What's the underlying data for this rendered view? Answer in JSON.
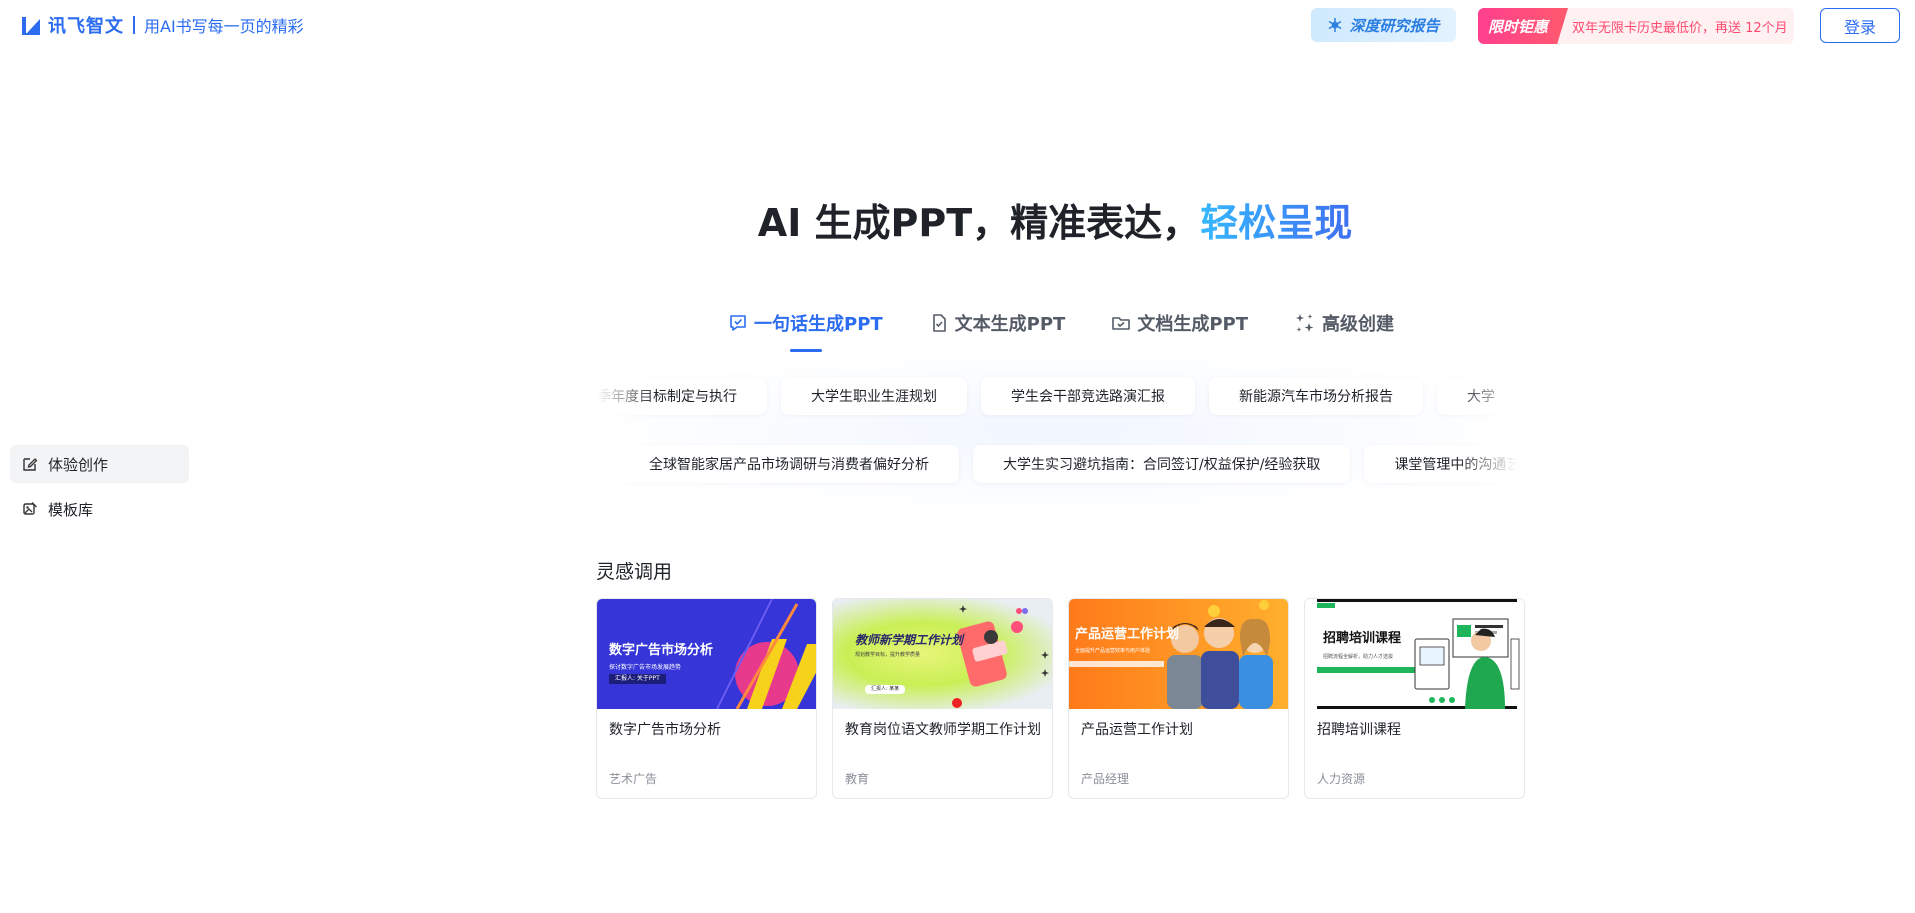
{
  "header": {
    "logo_name": "讯飞智文",
    "slogan": "用AI书写每一页的精彩",
    "deep_report": "深度研究报告",
    "promo_tag": "限时钜惠",
    "promo_text": "双年无限卡历史最低价，再送 12个月",
    "login": "登录"
  },
  "sidebar": {
    "items": [
      {
        "label": "体验创作",
        "icon": "edit-icon"
      },
      {
        "label": "模板库",
        "icon": "template-icon"
      }
    ]
  },
  "hero": {
    "title_main": "AI 生成PPT，精准表达，",
    "title_accent": "轻松呈现"
  },
  "tabs": [
    {
      "label": "一句话生成PPT",
      "icon": "chat-check-icon",
      "active": true
    },
    {
      "label": "文本生成PPT",
      "icon": "doc-check-icon",
      "active": false
    },
    {
      "label": "文档生成PPT",
      "icon": "folder-check-icon",
      "active": false
    },
    {
      "label": "高级创建",
      "icon": "sparkle-icon",
      "active": false
    }
  ],
  "suggestions": {
    "row1": [
      "季年度目标制定与执行",
      "大学生职业生涯规划",
      "学生会干部竞选路演汇报",
      "新能源汽车市场分析报告",
      "大学"
    ],
    "row2": [
      "全球智能家居产品市场调研与消费者偏好分析",
      "大学生实习避坑指南：合同签订/权益保护/经验获取",
      "课堂管理中的沟通艺"
    ]
  },
  "inspiration": {
    "title": "灵感调用",
    "cards": [
      {
        "name": "数字广告市场分析",
        "category": "艺术广告",
        "thumb_title": "数字广告市场分析",
        "thumb_subtitle": "探讨数字广告市场发展趋势",
        "thumb_button": "汇报人: 关于PPT"
      },
      {
        "name": "教育岗位语文教师学期工作计划",
        "category": "教育",
        "thumb_title": "教师新学期工作计划",
        "thumb_subtitle": "规划教学目标，提升教学质量",
        "thumb_button": "汇报人: 某某"
      },
      {
        "name": "产品运营工作计划",
        "category": "产品经理",
        "thumb_title": "产品运营工作计划",
        "thumb_subtitle": "全面提升产品运营效率与用户体验"
      },
      {
        "name": "招聘培训课程",
        "category": "人力资源",
        "thumb_title": "招聘培训课程",
        "thumb_subtitle": "招聘流程全解析，助力人才选拔"
      }
    ]
  },
  "colors": {
    "brand": "#2b6cf0",
    "accent_gradient_start": "#36b8ff",
    "promo_pink": "#ff3f8e"
  }
}
